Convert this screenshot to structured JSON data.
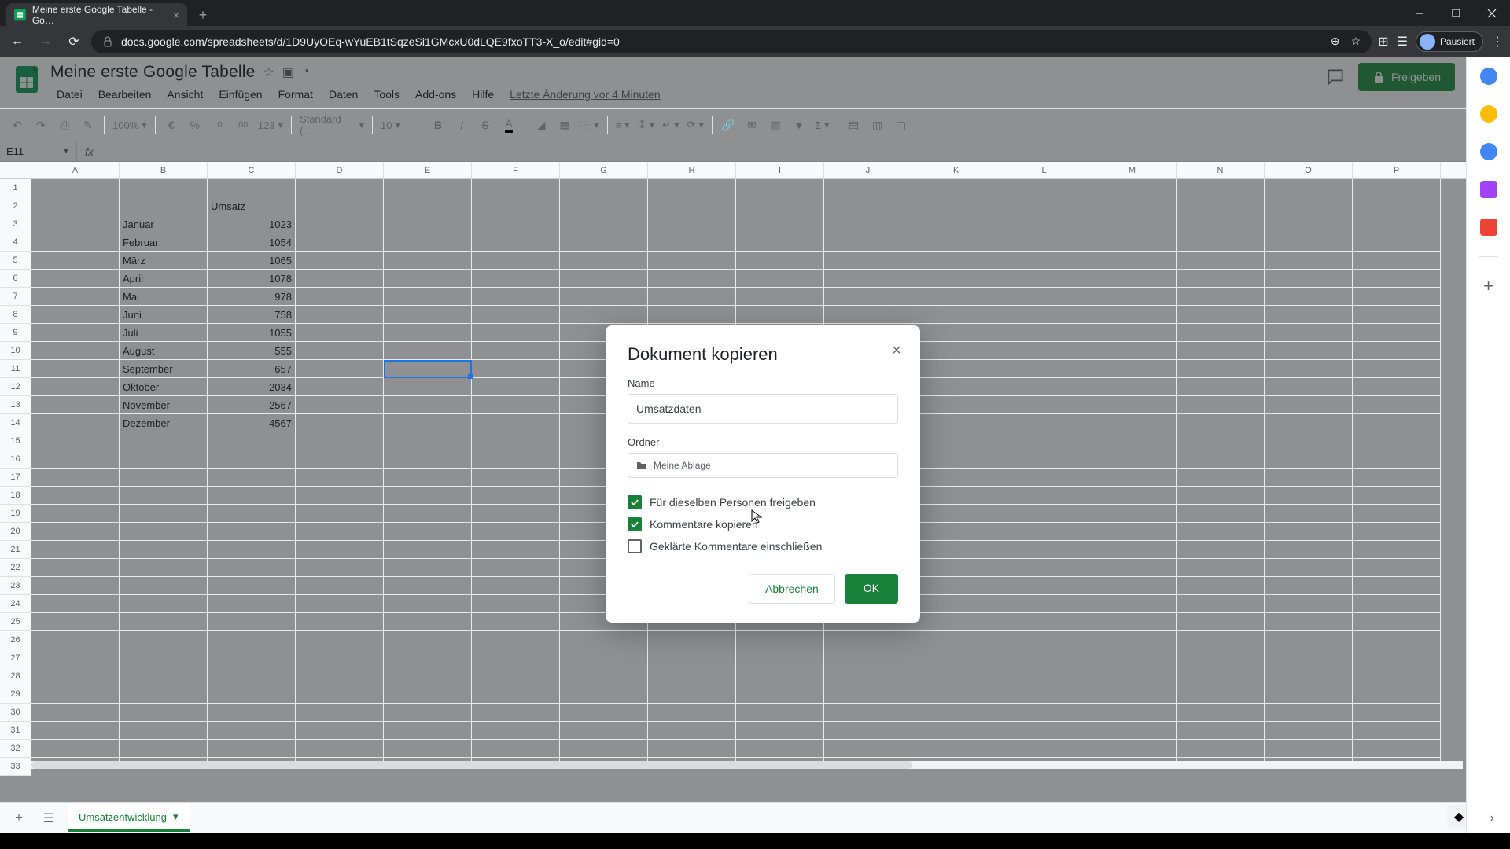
{
  "browser": {
    "tab_title": "Meine erste Google Tabelle - Go…",
    "url": "docs.google.com/spreadsheets/d/1D9UyOEq-wYuEB1tSqzeSi1GMcxU0dLQE9fxoTT3-X_o/edit#gid=0",
    "paused": "Pausiert"
  },
  "doc": {
    "title": "Meine erste Google Tabelle",
    "share": "Freigeben",
    "last_edit": "Letzte Änderung vor 4 Minuten",
    "menus": [
      "Datei",
      "Bearbeiten",
      "Ansicht",
      "Einfügen",
      "Format",
      "Daten",
      "Tools",
      "Add-ons",
      "Hilfe"
    ]
  },
  "toolbar": {
    "zoom": "100%",
    "currency": "€",
    "percent": "%",
    "dec_less": ".0",
    "dec_more": ".00",
    "num_format": "123",
    "font": "Standard (…",
    "font_size": "10"
  },
  "name_box": "E11",
  "columns": [
    "A",
    "B",
    "C",
    "D",
    "E",
    "F",
    "G",
    "H",
    "I",
    "J",
    "K",
    "L",
    "M",
    "N",
    "O",
    "P"
  ],
  "chart_data": {
    "type": "table",
    "header_cell": {
      "row": 2,
      "col": "C",
      "value": "Umsatz"
    },
    "rows": [
      {
        "month": "Januar",
        "value": 1023
      },
      {
        "month": "Februar",
        "value": 1054
      },
      {
        "month": "März",
        "value": 1065
      },
      {
        "month": "April",
        "value": 1078
      },
      {
        "month": "Mai",
        "value": 978
      },
      {
        "month": "Juni",
        "value": 758
      },
      {
        "month": "Juli",
        "value": 1055
      },
      {
        "month": "August",
        "value": 555
      },
      {
        "month": "September",
        "value": 657
      },
      {
        "month": "Oktober",
        "value": 2034
      },
      {
        "month": "November",
        "value": 2567
      },
      {
        "month": "Dezember",
        "value": 4567
      }
    ]
  },
  "active_cell": "E11",
  "sheet_tab": "Umsatzentwicklung",
  "dialog": {
    "title": "Dokument kopieren",
    "name_label": "Name",
    "name_value": "Umsatzdaten",
    "folder_label": "Ordner",
    "folder_value": "Meine Ablage",
    "chk1": "Für dieselben Personen freigeben",
    "chk2": "Kommentare kopieren",
    "chk3": "Geklärte Kommentare einschließen",
    "cancel": "Abbrechen",
    "ok": "OK"
  }
}
